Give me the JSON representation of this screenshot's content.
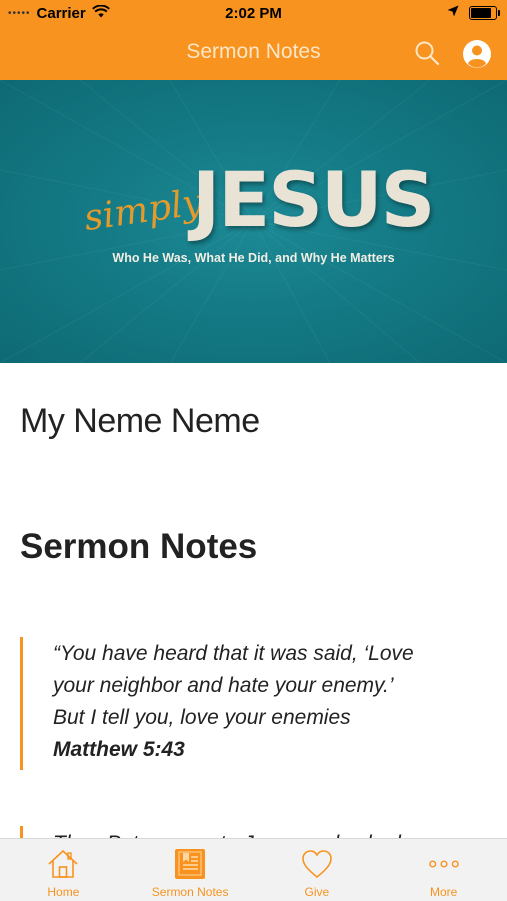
{
  "status_bar": {
    "signal": "•••••",
    "carrier": "Carrier",
    "time": "2:02 PM",
    "battery_level": 0.9
  },
  "header": {
    "title": "Sermon Notes",
    "search_icon": "search-icon",
    "profile_icon": "profile-icon"
  },
  "hero": {
    "script_word": "simply",
    "title": "JESUS",
    "subtitle": "Who He Was, What He Did, and Why He Matters"
  },
  "content": {
    "title": "My Neme Neme",
    "section_heading": "Sermon Notes",
    "quotes": [
      {
        "lines": [
          "“You have heard that it was said, ‘Love",
          "your neighbor and hate your enemy.’",
          "But I tell you, love your enemies"
        ],
        "reference": "Matthew 5:43"
      },
      {
        "lines": [
          "Then Peter came to Jesus and asked"
        ]
      }
    ]
  },
  "tabs": [
    {
      "label": "Home",
      "icon": "home-icon"
    },
    {
      "label": "Sermon Notes",
      "icon": "notes-icon"
    },
    {
      "label": "Give",
      "icon": "heart-icon"
    },
    {
      "label": "More",
      "icon": "more-icon"
    }
  ],
  "colors": {
    "accent": "#f7931e",
    "hero_bg": "#147a85",
    "text": "#222222"
  }
}
